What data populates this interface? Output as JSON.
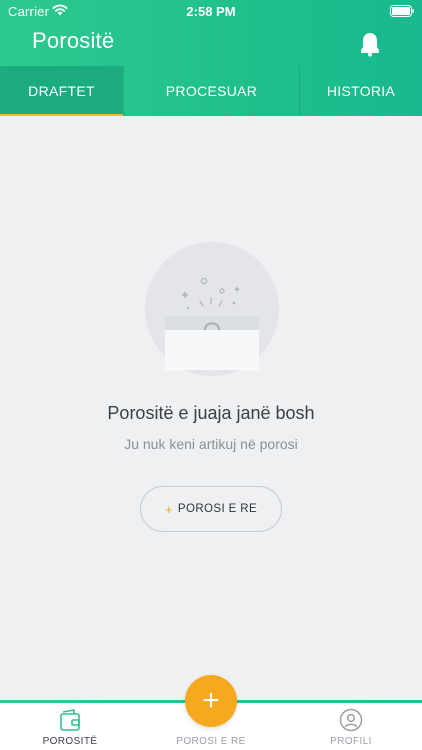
{
  "status_bar": {
    "carrier": "Carrier",
    "time": "2:58 PM"
  },
  "header": {
    "title": "Porositë",
    "bell_icon": "bell-icon"
  },
  "tabs": [
    {
      "label": "DRAFTET",
      "active": true
    },
    {
      "label": "PROCESUAR",
      "active": false
    },
    {
      "label": "HISTORIA",
      "active": false
    }
  ],
  "empty_state": {
    "illustration": "empty-box-icon",
    "title": "Porositë e juaja janë bosh",
    "subtitle": "Ju nuk keni artikuj në porosi",
    "button_plus": "+",
    "button_label": "POROSI E RE"
  },
  "tabbar": {
    "items": [
      {
        "label": "POROSITË",
        "icon": "orders-icon",
        "active": true
      },
      {
        "label": "POROSI E RE",
        "icon": "add-icon",
        "active": false
      },
      {
        "label": "PROFILI",
        "icon": "profile-icon",
        "active": false
      }
    ],
    "fab_symbol": "+"
  },
  "colors": {
    "brand_green": "#1fbf8c",
    "accent_orange": "#f5a91f",
    "background": "#eef0f2"
  }
}
